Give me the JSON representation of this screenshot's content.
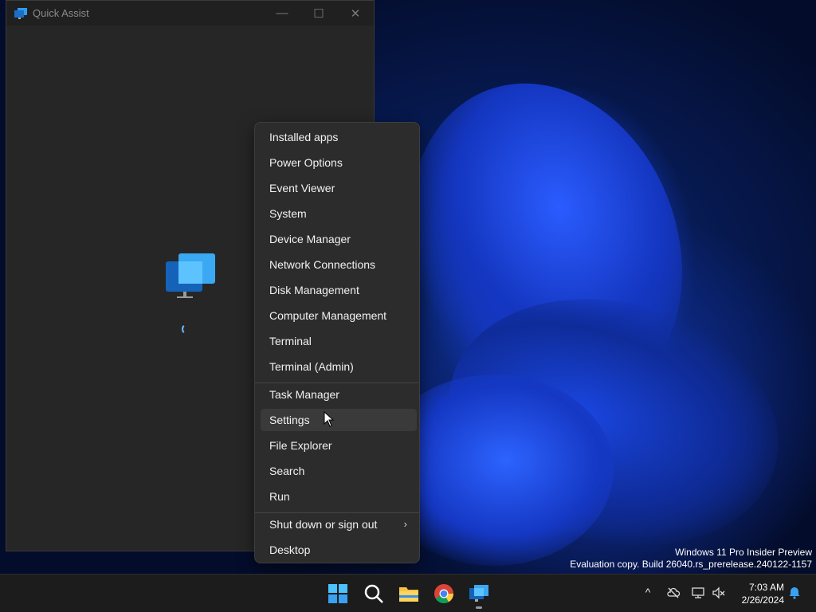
{
  "window": {
    "title": "Quick Assist",
    "minimize_glyph": "—",
    "maximize_glyph": "☐",
    "close_glyph": "✕"
  },
  "context_menu": {
    "groups": [
      [
        "Installed apps",
        "Power Options",
        "Event Viewer",
        "System",
        "Device Manager",
        "Network Connections",
        "Disk Management",
        "Computer Management",
        "Terminal",
        "Terminal (Admin)"
      ],
      [
        "Task Manager",
        "Settings",
        "File Explorer",
        "Search",
        "Run"
      ],
      [
        "Shut down or sign out",
        "Desktop"
      ]
    ],
    "hovered_item": "Settings",
    "submenu_chevron": "›"
  },
  "watermark": {
    "line1": "Windows 11 Pro Insider Preview",
    "line2": "Evaluation copy. Build 26040.rs_prerelease.240122-1157"
  },
  "taskbar": {
    "apps": [
      "start-icon",
      "search-icon",
      "file-explorer-icon",
      "chrome-icon",
      "quick-assist-icon"
    ],
    "tray": {
      "chevron_glyph": "^",
      "time": "7:03 AM",
      "date": "2/26/2024"
    }
  },
  "colors": {
    "accent": "#0078d4",
    "menu_bg": "#2c2c2c",
    "taskbar_bg": "#1c1c1c"
  }
}
